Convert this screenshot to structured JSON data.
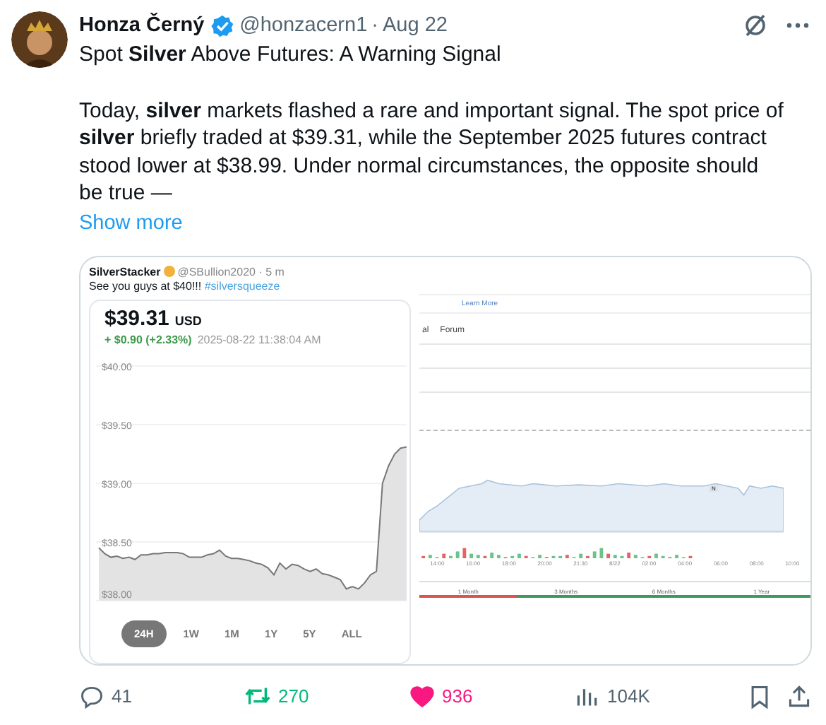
{
  "author": {
    "name": "Honza Černý",
    "verified": true,
    "handle": "@honzacern1",
    "separator": "·",
    "date": "Aug 22"
  },
  "title": "Spot **Silver** Above Futures: A Warning Signal",
  "body": "Today, **silver** markets flashed a rare and important signal. The spot price of **silver** briefly traded at $39.31, while the September 2025 futures contract stood lower at $38.99. Under normal circumstances, the opposite should be true —",
  "show_more": "Show more",
  "embedded": {
    "author": {
      "name": "SilverStacker",
      "verified": true,
      "handle": "@SBullion2020 · 5 m"
    },
    "text": "See you guys at $40!!!",
    "hashtag": "#silversqueeze",
    "price_card": {
      "price": "$39.31",
      "currency": "USD",
      "change": "+ $0.90 (+2.33%)",
      "timestamp": "2025-08-22 11:38:04 AM",
      "chart_data": {
        "type": "area",
        "grid": true,
        "ylim": [
          38,
          40
        ],
        "yticks": [
          {
            "value": 40,
            "label": "$40.00"
          },
          {
            "value": 39.5,
            "label": "$39.50"
          },
          {
            "value": 39,
            "label": "$39.00"
          },
          {
            "value": 38.5,
            "label": "$38.50"
          },
          {
            "value": 38,
            "label": "$38.00"
          }
        ],
        "series": [
          {
            "color": "#777777",
            "values": [
              38.45,
              38.4,
              38.37,
              38.38,
              38.36,
              38.37,
              38.35,
              38.39,
              38.39,
              38.4,
              38.4,
              38.41,
              38.41,
              38.41,
              38.4,
              38.37,
              38.37,
              38.37,
              38.39,
              38.4,
              38.43,
              38.38,
              38.36,
              38.36,
              38.35,
              38.34,
              38.32,
              38.31,
              38.28,
              38.22,
              38.32,
              38.27,
              38.31,
              38.3,
              38.27,
              38.25,
              38.27,
              38.23,
              38.22,
              38.2,
              38.18,
              38.1,
              38.12,
              38.1,
              38.15,
              38.22,
              38.25,
              39.0,
              39.15,
              39.25,
              39.3,
              39.31
            ]
          }
        ]
      },
      "ranges": [
        {
          "label": "24H",
          "selected": true
        },
        {
          "label": "1W",
          "selected": false
        },
        {
          "label": "1M",
          "selected": false
        },
        {
          "label": "1Y",
          "selected": false
        },
        {
          "label": "5Y",
          "selected": false
        },
        {
          "label": "ALL",
          "selected": false
        }
      ]
    },
    "right_panel": {
      "link": "Learn More",
      "tabs": [
        {
          "label": "al"
        },
        {
          "label": "Forum"
        }
      ],
      "time_ticks": [
        "14:00",
        "16:00",
        "18:00",
        "20:00",
        "21:30",
        "8/22",
        "02:00",
        "04:00",
        "06:00",
        "08:00",
        "10:00"
      ],
      "marker": "N",
      "periods": [
        {
          "label": "1 Month",
          "color": "#d9534f"
        },
        {
          "label": "3 Months",
          "color": "#3c9a5f"
        },
        {
          "label": "6 Months",
          "color": "#3c9a5f"
        },
        {
          "label": "1 Year",
          "color": "#3c9a5f"
        }
      ]
    }
  },
  "actions": [
    {
      "kind": "reply",
      "count": "41"
    },
    {
      "kind": "repost",
      "count": "270"
    },
    {
      "kind": "like",
      "count": "936",
      "liked": true
    },
    {
      "kind": "views",
      "count": "104K"
    },
    {
      "kind": "bookmark"
    },
    {
      "kind": "share"
    }
  ]
}
